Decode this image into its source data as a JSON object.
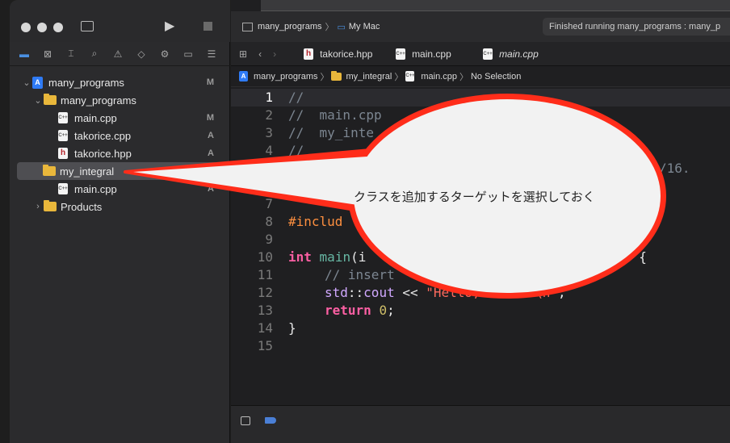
{
  "window": {
    "scheme": "many_programs",
    "destination": "My Mac",
    "status": "Finished running many_programs : many_p"
  },
  "sidebar": {
    "items": [
      {
        "label": "many_programs",
        "badge": "M"
      },
      {
        "label": "many_programs",
        "badge": ""
      },
      {
        "label": "main.cpp",
        "badge": "M"
      },
      {
        "label": "takorice.cpp",
        "badge": "A"
      },
      {
        "label": "takorice.hpp",
        "badge": "A"
      },
      {
        "label": "my_integral",
        "badge": ""
      },
      {
        "label": "main.cpp",
        "badge": "A"
      },
      {
        "label": "Products",
        "badge": ""
      }
    ]
  },
  "tabs": [
    {
      "label": "takorice.hpp",
      "icon": "h-file-icon"
    },
    {
      "label": "main.cpp",
      "icon": "cpp-file-icon"
    },
    {
      "label": "main.cpp",
      "icon": "cpp-file-icon"
    }
  ],
  "jumpbar": [
    "many_programs",
    "my_integral",
    "main.cpp",
    "No Selection"
  ],
  "editor": {
    "line_numbers": [
      "1",
      "2",
      "3",
      "4",
      "5",
      "6",
      "7",
      "8",
      "9",
      "10",
      "11",
      "12",
      "13",
      "14",
      "15"
    ],
    "visible_code": {
      "l1": "//",
      "l2": "//  main.cpp",
      "l3": "//  my_inte",
      "l4": "//",
      "l5": "//",
      "l5_tail": "/16.",
      "l8_include": "#includ",
      "l10_int": "int",
      "l10_main": "main",
      "l10_paren": "(i",
      "l10_brace": "/ {",
      "l11": "// insert",
      "l12_std": "std",
      "l12_sep": "::",
      "l12_cout": "cout",
      "l12_op": " << ",
      "l12_str": "\"Hello, World!\\n\"",
      "l12_end": ";",
      "l13_ret": "return",
      "l13_num": "0",
      "l13_end": ";",
      "l14": "}"
    }
  },
  "callout": {
    "text": "クラスを追加するターゲットを選択しておく",
    "color": "#ff2d1a"
  }
}
